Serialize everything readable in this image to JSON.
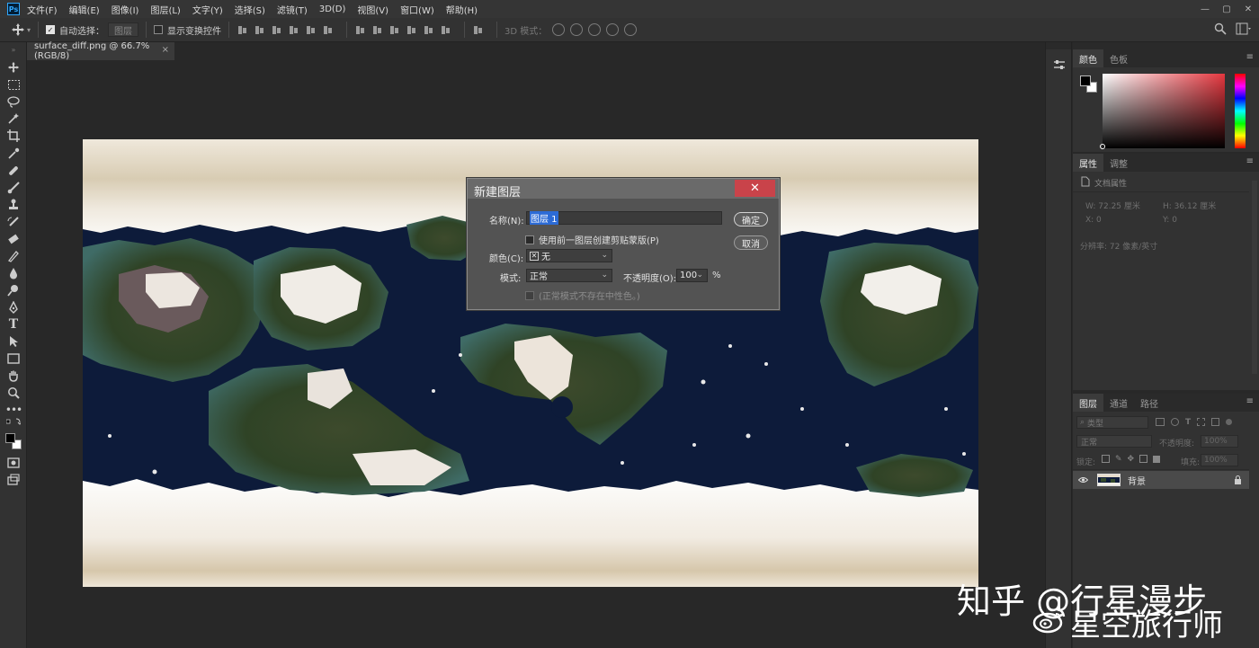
{
  "app": {
    "logo": "Ps"
  },
  "menu": [
    "文件(F)",
    "编辑(E)",
    "图像(I)",
    "图层(L)",
    "文字(Y)",
    "选择(S)",
    "滤镜(T)",
    "3D(D)",
    "视图(V)",
    "窗口(W)",
    "帮助(H)"
  ],
  "window_controls": [
    "—",
    "▢",
    "✕"
  ],
  "options": {
    "auto_select_label": "自动选择：",
    "auto_select_target": "图层",
    "show_transform_label": "显示变换控件",
    "mode_3d_label": "3D 模式："
  },
  "document_tab": {
    "title": "surface_diff.png @ 66.7%(RGB/8)",
    "close": "×"
  },
  "dialog": {
    "title": "新建图层",
    "close": "✕",
    "name_label": "名称(N):",
    "name_value": "图层 1",
    "clip_label": "使用前一图层创建剪贴蒙版(P)",
    "color_label": "颜色(C):",
    "color_value": "无",
    "mode_label": "模式:",
    "mode_value": "正常",
    "opacity_label": "不透明度(O):",
    "opacity_value": "100",
    "opacity_unit": "%",
    "neutral_label": "(正常模式不存在中性色。)",
    "ok_label": "确定",
    "cancel_label": "取消"
  },
  "color_panel": {
    "tabs": [
      "颜色",
      "色板"
    ],
    "foreground": "#000000",
    "background": "#ffffff",
    "hue_color": "#e5373f"
  },
  "properties_panel": {
    "tabs": [
      "属性",
      "调整"
    ],
    "doc_props_label": "文档属性",
    "w_label": "W:  72.25 厘米",
    "h_label": "H:  36.12 厘米",
    "x_label": "X:  0",
    "y_label": "Y:  0",
    "resolution_label": "分辨率: 72 像素/英寸"
  },
  "layers_panel": {
    "tabs": [
      "图层",
      "通道",
      "路径"
    ],
    "filter_kind": "类型",
    "blend_mode": "正常",
    "opacity_label": "不透明度:",
    "opacity_value": "100%",
    "lock_label": "锁定:",
    "fill_label": "填充:",
    "fill_value": "100%",
    "layers": [
      {
        "name": "背景",
        "visible": true,
        "locked": true
      }
    ]
  },
  "watermark": {
    "line1": "知乎 @行星漫步",
    "line2": "星空旅行师"
  }
}
